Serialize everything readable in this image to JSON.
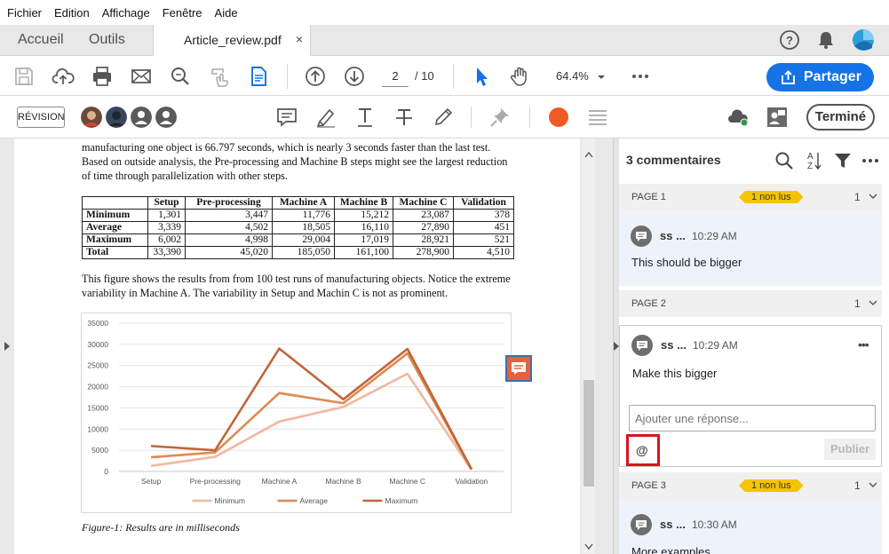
{
  "menu": [
    "Fichier",
    "Edition",
    "Affichage",
    "Fenêtre",
    "Aide"
  ],
  "tabs": {
    "home": "Accueil",
    "tools": "Outils",
    "document": "Article_review.pdf",
    "close": "×"
  },
  "toolbar": {
    "page_current": "2",
    "page_total": "/ 10",
    "zoom": "64.4%",
    "share_label": "Partager"
  },
  "review": {
    "mode_label": "RÉVISION",
    "done_label": "Terminé"
  },
  "document": {
    "para1": "manufacturing one object is 66.797 seconds, which is nearly 3 seconds faster than the last test. Based on outside analysis, the Pre-processing and Machine B steps might see the largest reduction of time through parallelization with other steps.",
    "para2": "This figure shows the results from from 100 test runs of manufacturing objects. Notice the extreme variability in Machine A. The variability in Setup and Machin C is not as prominent.",
    "table": {
      "headers": [
        "",
        "Setup",
        "Pre-processing",
        "Machine A",
        "Machine B",
        "Machine C",
        "Validation"
      ],
      "rows": [
        [
          "Minimum",
          "1,301",
          "3,447",
          "11,776",
          "15,212",
          "23,087",
          "378"
        ],
        [
          "Average",
          "3,339",
          "4,502",
          "18,505",
          "16,110",
          "27,890",
          "451"
        ],
        [
          "Maximum",
          "6,002",
          "4,998",
          "29,004",
          "17,019",
          "28,921",
          "521"
        ],
        [
          "Total",
          "33,390",
          "45,020",
          "185,050",
          "161,100",
          "278,900",
          "4,510"
        ]
      ]
    },
    "caption": "Figure-1: Results are in milliseconds"
  },
  "chart_data": {
    "type": "line",
    "categories": [
      "Setup",
      "Pre-processing",
      "Machine A",
      "Machine B",
      "Machine C",
      "Validation"
    ],
    "series": [
      {
        "name": "Minimum",
        "values": [
          1301,
          3447,
          11776,
          15212,
          23087,
          378
        ],
        "color": "#f0b8a0"
      },
      {
        "name": "Average",
        "values": [
          3339,
          4502,
          18505,
          16110,
          27890,
          451
        ],
        "color": "#e08a50"
      },
      {
        "name": "Maximum",
        "values": [
          6002,
          4998,
          29004,
          17019,
          28921,
          521
        ],
        "color": "#c0663a"
      }
    ],
    "yticks": [
      "0",
      "5000",
      "10000",
      "15000",
      "20000",
      "25000",
      "30000",
      "35000"
    ],
    "ylim": [
      0,
      35000
    ],
    "grid": true,
    "legend": "bottom"
  },
  "comments": {
    "header": "3 commentaires",
    "pages": [
      {
        "label": "PAGE 1",
        "badge": "1 non lus",
        "count": "1",
        "comment": {
          "author": "ss ...",
          "time": "10:29 AM",
          "text": "This should be bigger"
        }
      },
      {
        "label": "PAGE 2",
        "badge": "",
        "count": "1",
        "comment": {
          "author": "ss ...",
          "time": "10:29 AM",
          "text": "Make this bigger",
          "more": "•••"
        },
        "reply_placeholder": "Ajouter une réponse...",
        "mention": "@",
        "publish": "Publier"
      },
      {
        "label": "PAGE 3",
        "badge": "1 non lus",
        "count": "1",
        "comment": {
          "author": "ss ...",
          "time": "10:30 AM",
          "text": "More examples"
        }
      }
    ]
  }
}
